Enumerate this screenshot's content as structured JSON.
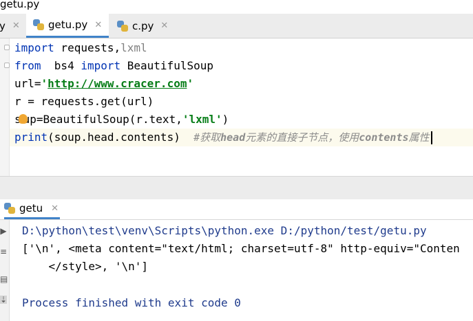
{
  "window": {
    "title": "getu.py"
  },
  "tabs": [
    {
      "name": "y",
      "close": "✕"
    },
    {
      "name": "getu.py",
      "close": "✕",
      "active": true
    },
    {
      "name": "c.py",
      "close": "✕"
    }
  ],
  "code": {
    "line1": {
      "kw": "import",
      "text": " requests,",
      "gray": "lxml"
    },
    "line2": {
      "kw": "from",
      "text": "  bs4 ",
      "kw2": "import",
      "text2": " BeautifulSoup"
    },
    "line3": {
      "text": "url=",
      "q1": "'",
      "url": "http://www.cracer.com",
      "q2": "'"
    },
    "line4": {
      "text": "r = requests.get(url)"
    },
    "line5": {
      "pre": "s",
      "post": "up=BeautifulSoup(r.text,",
      "str": "'lxml'",
      "close": ")"
    },
    "line6": {
      "fn": "print",
      "text": "(soup.head.contents)  ",
      "c1": "#获取",
      "c2": "head",
      "c3": "元素的直接子节点，使用",
      "c4": "contents",
      "c5": "属性"
    }
  },
  "run": {
    "tab_label": "getu",
    "close": "✕",
    "lines": {
      "cmd": "D:\\python\\test\\venv\\Scripts\\python.exe D:/python/test/getu.py",
      "out1": "['\\n', <meta content=\"text/html; charset=utf-8\" http-equiv=\"Conten",
      "out2": "    </style>, '\\n']",
      "done": "Process finished with exit code 0"
    }
  },
  "icons": [
    "python-file-icon",
    "lightbulb-icon",
    "run-icon",
    "close-icon"
  ],
  "colors": {
    "keyword": "#0033b3",
    "string": "#067d17",
    "comment": "#8c8c8c",
    "accent": "#4083c9"
  }
}
